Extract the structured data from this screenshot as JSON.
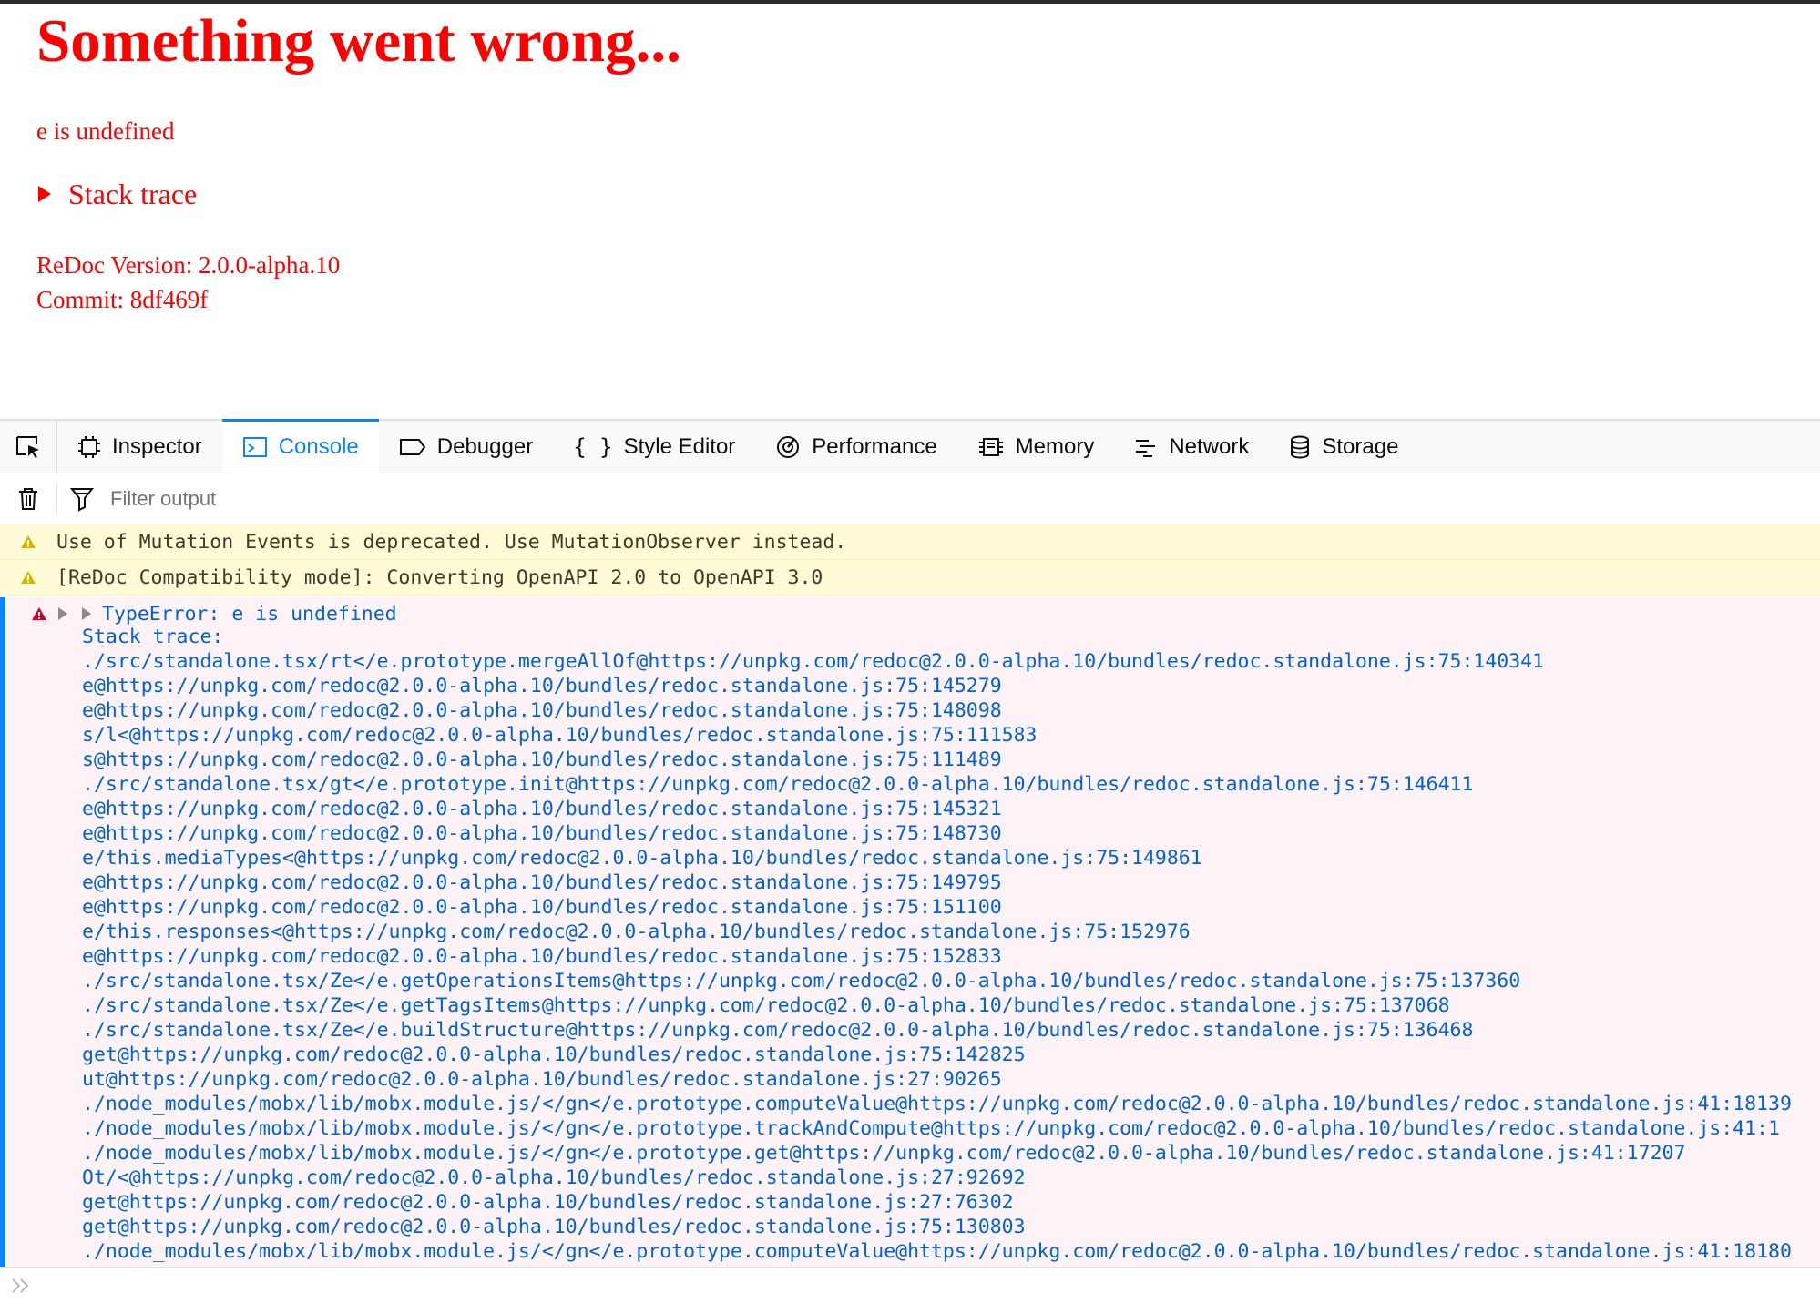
{
  "page": {
    "title": "Something went wrong...",
    "message": "e is undefined",
    "stack_toggle": "Stack trace",
    "version": "ReDoc Version: 2.0.0-alpha.10",
    "commit": "Commit: 8df469f"
  },
  "devtools": {
    "tabs": [
      {
        "label": "Inspector",
        "icon": "inspector-icon"
      },
      {
        "label": "Console",
        "icon": "console-icon",
        "active": true
      },
      {
        "label": "Debugger",
        "icon": "debugger-icon"
      },
      {
        "label": "Style Editor",
        "icon": "style-editor-icon"
      },
      {
        "label": "Performance",
        "icon": "performance-icon"
      },
      {
        "label": "Memory",
        "icon": "memory-icon"
      },
      {
        "label": "Network",
        "icon": "network-icon"
      },
      {
        "label": "Storage",
        "icon": "storage-icon"
      }
    ],
    "filter_placeholder": "Filter output",
    "accent_color": "#0a84ff"
  },
  "console": {
    "warnings": [
      "Use of Mutation Events is deprecated. Use MutationObserver instead.",
      "[ReDoc Compatibility mode]: Converting OpenAPI 2.0 to OpenAPI 3.0"
    ],
    "error": {
      "head": "TypeError: e is undefined",
      "stack_label": "Stack trace:",
      "frames": [
        "./src/standalone.tsx/rt</e.prototype.mergeAllOf@https://unpkg.com/redoc@2.0.0-alpha.10/bundles/redoc.standalone.js:75:140341",
        "e@https://unpkg.com/redoc@2.0.0-alpha.10/bundles/redoc.standalone.js:75:145279",
        "e@https://unpkg.com/redoc@2.0.0-alpha.10/bundles/redoc.standalone.js:75:148098",
        "s/l<@https://unpkg.com/redoc@2.0.0-alpha.10/bundles/redoc.standalone.js:75:111583",
        "s@https://unpkg.com/redoc@2.0.0-alpha.10/bundles/redoc.standalone.js:75:111489",
        "./src/standalone.tsx/gt</e.prototype.init@https://unpkg.com/redoc@2.0.0-alpha.10/bundles/redoc.standalone.js:75:146411",
        "e@https://unpkg.com/redoc@2.0.0-alpha.10/bundles/redoc.standalone.js:75:145321",
        "e@https://unpkg.com/redoc@2.0.0-alpha.10/bundles/redoc.standalone.js:75:148730",
        "e/this.mediaTypes<@https://unpkg.com/redoc@2.0.0-alpha.10/bundles/redoc.standalone.js:75:149861",
        "e@https://unpkg.com/redoc@2.0.0-alpha.10/bundles/redoc.standalone.js:75:149795",
        "e@https://unpkg.com/redoc@2.0.0-alpha.10/bundles/redoc.standalone.js:75:151100",
        "e/this.responses<@https://unpkg.com/redoc@2.0.0-alpha.10/bundles/redoc.standalone.js:75:152976",
        "e@https://unpkg.com/redoc@2.0.0-alpha.10/bundles/redoc.standalone.js:75:152833",
        "./src/standalone.tsx/Ze</e.getOperationsItems@https://unpkg.com/redoc@2.0.0-alpha.10/bundles/redoc.standalone.js:75:137360",
        "./src/standalone.tsx/Ze</e.getTagsItems@https://unpkg.com/redoc@2.0.0-alpha.10/bundles/redoc.standalone.js:75:137068",
        "./src/standalone.tsx/Ze</e.buildStructure@https://unpkg.com/redoc@2.0.0-alpha.10/bundles/redoc.standalone.js:75:136468",
        "get@https://unpkg.com/redoc@2.0.0-alpha.10/bundles/redoc.standalone.js:75:142825",
        "ut@https://unpkg.com/redoc@2.0.0-alpha.10/bundles/redoc.standalone.js:27:90265",
        "./node_modules/mobx/lib/mobx.module.js/</gn</e.prototype.computeValue@https://unpkg.com/redoc@2.0.0-alpha.10/bundles/redoc.standalone.js:41:18139",
        "./node_modules/mobx/lib/mobx.module.js/</gn</e.prototype.trackAndCompute@https://unpkg.com/redoc@2.0.0-alpha.10/bundles/redoc.standalone.js:41:1",
        "./node_modules/mobx/lib/mobx.module.js/</gn</e.prototype.get@https://unpkg.com/redoc@2.0.0-alpha.10/bundles/redoc.standalone.js:41:17207",
        "Ot/<@https://unpkg.com/redoc@2.0.0-alpha.10/bundles/redoc.standalone.js:27:92692",
        "get@https://unpkg.com/redoc@2.0.0-alpha.10/bundles/redoc.standalone.js:27:76302",
        "get@https://unpkg.com/redoc@2.0.0-alpha.10/bundles/redoc.standalone.js:75:130803",
        "./node_modules/mobx/lib/mobx.module.js/</gn</e.prototype.computeValue@https://unpkg.com/redoc@2.0.0-alpha.10/bundles/redoc.standalone.js:41:18180"
      ]
    }
  }
}
